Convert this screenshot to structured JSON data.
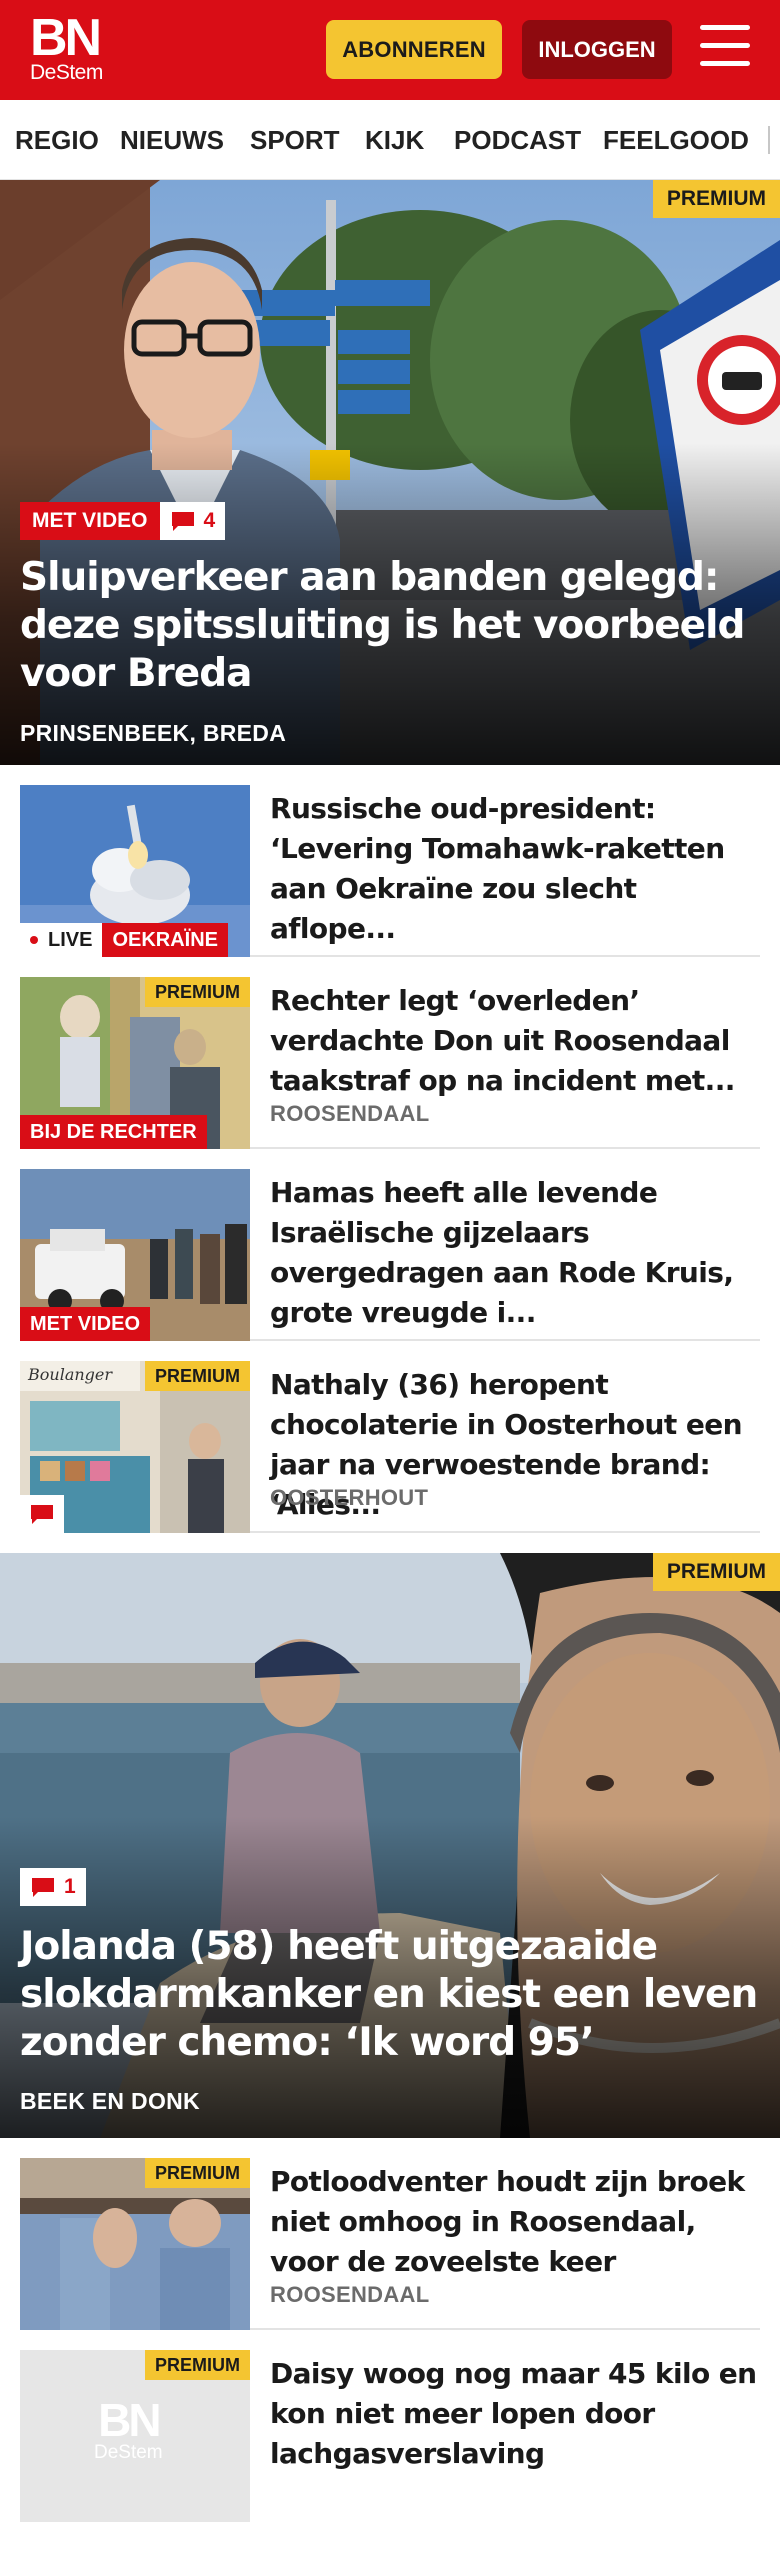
{
  "header": {
    "logo_main": "BN",
    "logo_sub": "DeStem",
    "subscribe_label": "ABONNEREN",
    "login_label": "INLOGGEN",
    "menu_icon": "hamburger-menu-icon"
  },
  "nav": {
    "items": [
      "REGIO",
      "NIEUWS",
      "SPORT",
      "KIJK",
      "PODCAST",
      "FEELGOOD"
    ]
  },
  "hero1": {
    "premium": "PREMIUM",
    "badge": "MET VIDEO",
    "comments": "4",
    "title": "Sluipverkeer aan banden gelegd: deze spitssluiting is het voorbeeld voor Breda",
    "location": "PRINSENBEEK, BREDA"
  },
  "articles": [
    {
      "title": "Russische oud-president: ‘Levering Tomahawk-raketten aan Oekraïne zou slecht aflope...",
      "live": "LIVE",
      "category": "OEKRAÏNE"
    },
    {
      "premium": "PREMIUM",
      "label": "BIJ DE RECHTER",
      "title": "Rechter legt ‘overleden’ verdachte Don uit Roosendaal taakstraf op na incident met...",
      "location": "ROOSENDAAL"
    },
    {
      "label": "MET VIDEO",
      "title": "Hamas heeft alle levende Israëli­sche gijzelaars overgedragen aan Rode Kruis, grote vreugde i..."
    },
    {
      "premium": "PREMIUM",
      "title": "Nathaly (36) heropent chocolate­rie in Oosterhout een jaar na verwoestende brand: ‘Alles...",
      "location": "OOSTERHOUT",
      "thumb_sign": "Boulanger"
    }
  ],
  "hero2": {
    "premium": "PREMIUM",
    "comments": "1",
    "title": "Jolanda (58) heeft uitgezaaide slokdarmkanker en kiest een leven zonder chemo: ‘Ik word 95’",
    "location": "BEEK EN DONK"
  },
  "articles2": [
    {
      "premium": "PREMIUM",
      "title": "Potloodventer houdt zijn broek niet omhoog in Roosendaal, voor de zoveelste keer",
      "location": "ROOSENDAAL"
    },
    {
      "premium": "PREMIUM",
      "title": "Daisy woog nog maar 45 kilo en kon niet meer lopen door lachgasverslaving",
      "placeholder_logo_main": "BN",
      "placeholder_logo_sub": "DeStem"
    }
  ],
  "colors": {
    "brand_red": "#d90d16",
    "premium_yellow": "#f4c531",
    "login_dark_red": "#8e0a0f"
  }
}
